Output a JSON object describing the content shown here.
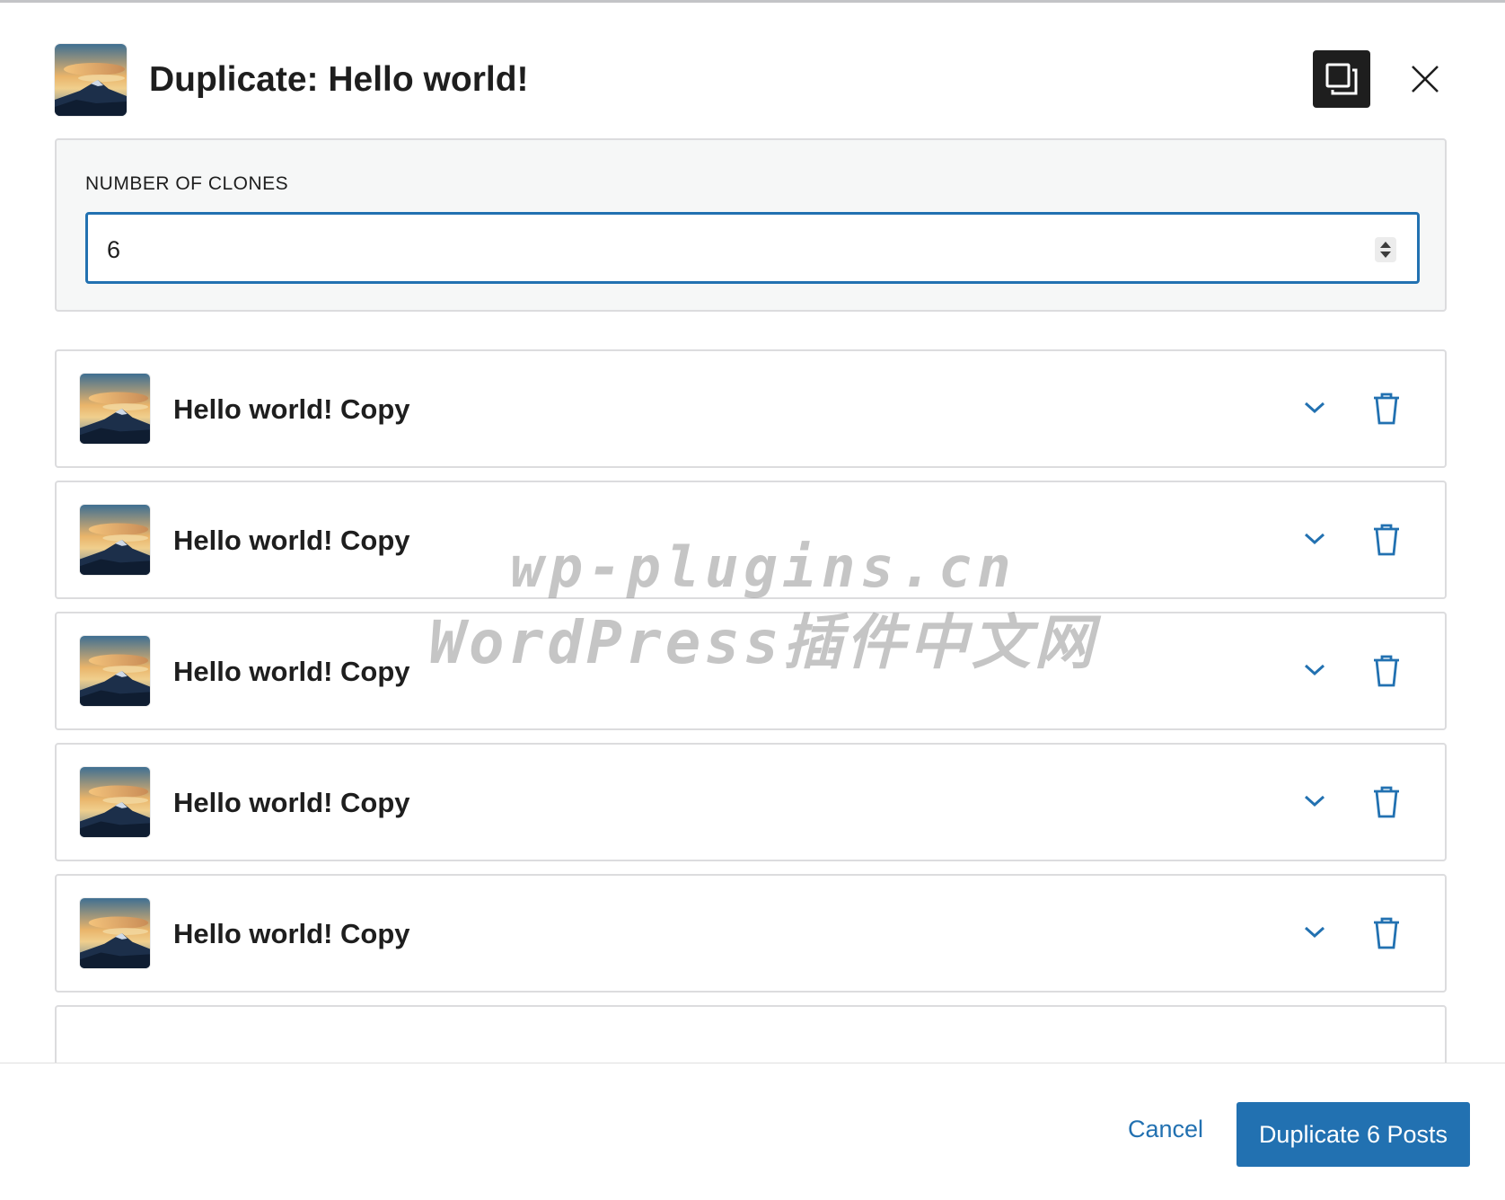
{
  "dialog": {
    "title": "Duplicate: Hello world!",
    "featured_image_icon": "mountain-sunset-thumbnail",
    "duplicate_icon": "copy-icon",
    "close_icon": "close-icon"
  },
  "clones": {
    "label": "NUMBER OF CLONES",
    "value": "6"
  },
  "posts": [
    {
      "title": "Hello world! Copy"
    },
    {
      "title": "Hello world! Copy"
    },
    {
      "title": "Hello world! Copy"
    },
    {
      "title": "Hello world! Copy"
    },
    {
      "title": "Hello world! Copy"
    },
    {
      "title": ""
    }
  ],
  "footer": {
    "cancel_label": "Cancel",
    "primary_label": "Duplicate 6 Posts"
  },
  "watermark": {
    "line1": "wp-plugins.cn",
    "line2": "WordPress插件中文网"
  },
  "colors": {
    "accent": "#2271b1",
    "text": "#1e1e1e",
    "panel_bg": "#f6f7f7",
    "border": "#dcdcde",
    "dark_button": "#1e1e1e"
  }
}
